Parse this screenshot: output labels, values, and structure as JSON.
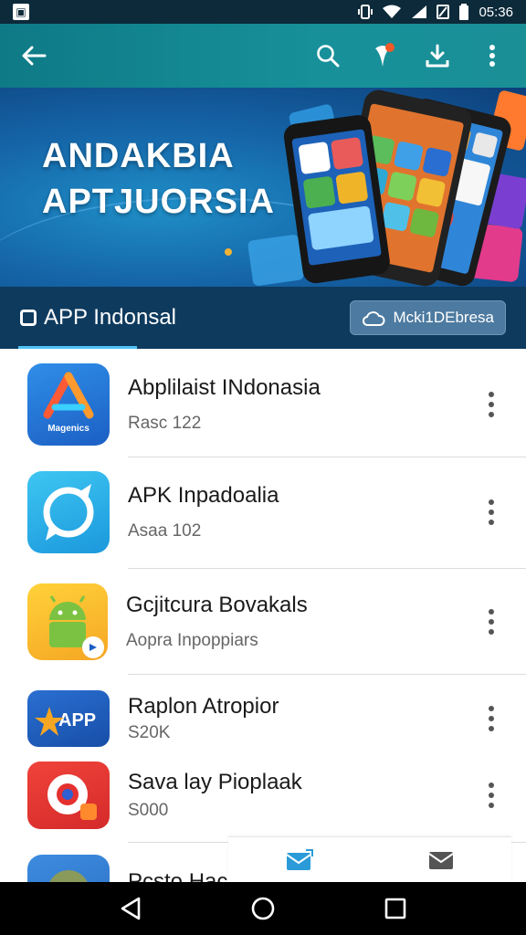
{
  "status_bar": {
    "time": "05:36"
  },
  "banner": {
    "line1": "ANDAKBIA",
    "line2": "APTJUORSIA"
  },
  "tabs": {
    "active_label": "APP Indonsal",
    "button_label": "Mcki1DEbresa"
  },
  "apps": [
    {
      "name": "Abplilaist INdonasia",
      "sub": "Rasc 122"
    },
    {
      "name": "APK Inpadoalia",
      "sub": "Asaa 102"
    },
    {
      "name": "Gcjitcura Bovakals",
      "sub": "Aopra Inpoppiars"
    },
    {
      "name": "Raplon Atropior",
      "sub": "S20K"
    },
    {
      "name": "Sava lay Pioplaak",
      "sub": "S000"
    },
    {
      "name": "Pcsto Haci",
      "sub": ""
    }
  ],
  "icon_texts": {
    "app1": "Magenics",
    "app4": "APP"
  },
  "colors": {
    "appbar": "#0e7a86",
    "tabbar": "#0e3a5e",
    "accent": "#4fc3f7"
  }
}
